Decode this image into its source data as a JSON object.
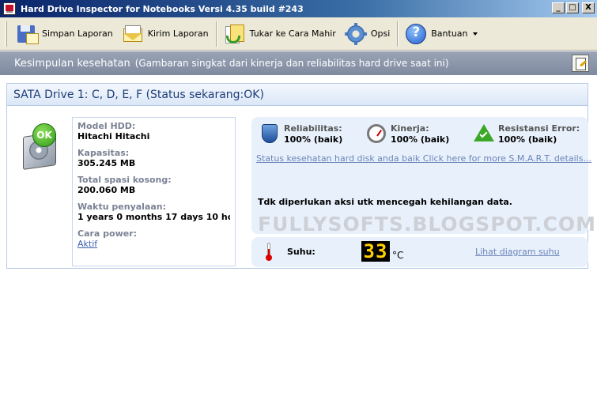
{
  "window": {
    "title": "Hard Drive Inspector for Notebooks Versi 4.35 build #243",
    "minimize": "_",
    "maximize": "□",
    "close": "X"
  },
  "toolbar": {
    "items": [
      {
        "label": "Simpan Laporan",
        "icon": "floppy-save-icon"
      },
      {
        "label": "Kirim Laporan",
        "icon": "mail-icon"
      },
      {
        "label": "Tukar ke Cara Mahir",
        "icon": "swap-mode-icon"
      },
      {
        "label": "Opsi",
        "icon": "gear-icon"
      },
      {
        "label": "Bantuan",
        "icon": "help-icon"
      }
    ]
  },
  "header": {
    "title": "Kesimpulan kesehatan",
    "subtitle": "(Gambaran singkat dari kinerja dan reliabilitas hard drive saat ini)"
  },
  "drive": {
    "title": "SATA Drive 1: C, D, E, F (Status sekarang:OK)",
    "badge": "OK",
    "model_label": "Model HDD:",
    "model_value": "Hitachi Hitachi",
    "capacity_label": "Kapasitas:",
    "capacity_value": "305.245 MB",
    "free_label": "Total spasi kosong:",
    "free_value": "200.060 MB",
    "uptime_label": "Waktu penyalaan:",
    "uptime_value": "1 years 0 months 17 days 10 ho...",
    "power_label": "Cara power:",
    "power_value": "Aktif"
  },
  "status": {
    "reliability_label": "Reliabilitas:",
    "reliability_value": "100% (baik)",
    "performance_label": "Kinerja:",
    "performance_value": "100% (baik)",
    "error_label": "Resistansi Error:",
    "error_value": "100% (baik)",
    "smart_link": "Status kesehatan hard disk anda baik Click here for more S.M.A.R.T. details...",
    "message": "Tdk diperlukan aksi utk mencegah kehilangan data.",
    "watermark": "FULLYSOFTS.BLOGSPOT.COM"
  },
  "temperature": {
    "label": "Suhu:",
    "value": "33",
    "unit": "°C",
    "link": "Lihat diagram suhu"
  }
}
